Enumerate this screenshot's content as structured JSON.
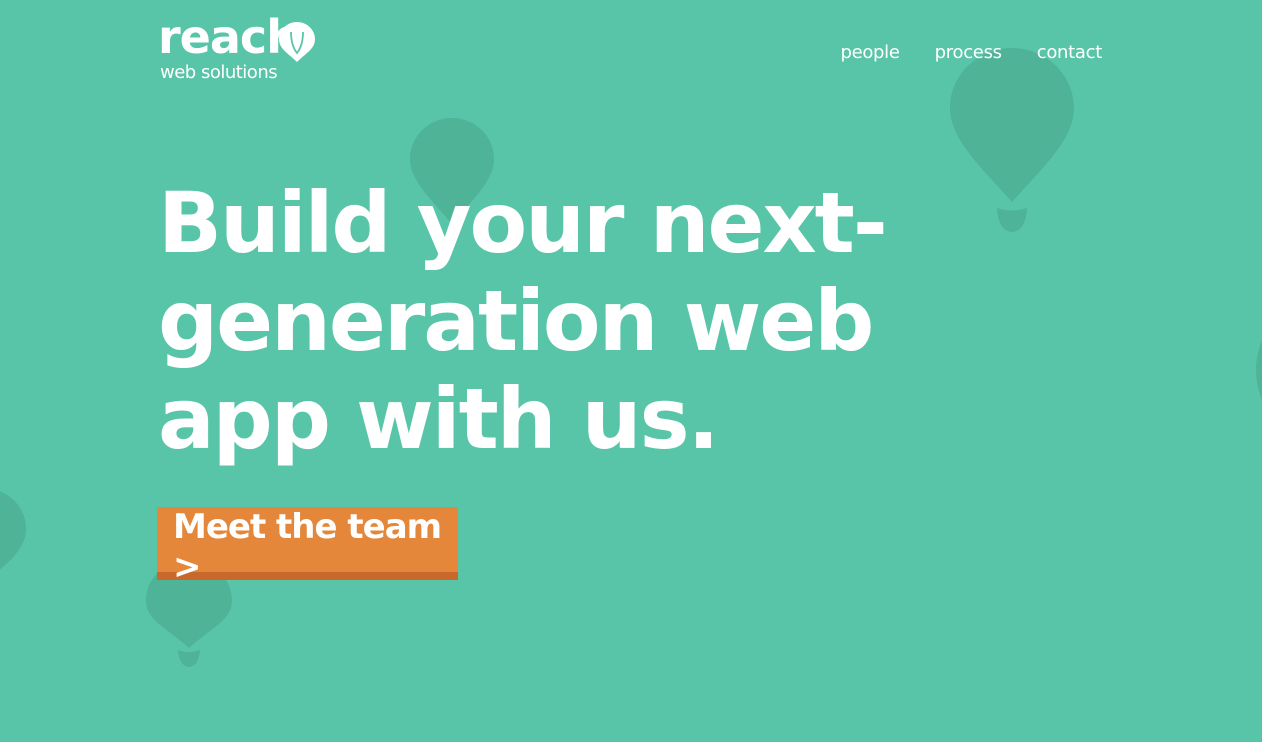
{
  "colors": {
    "background": "#59c5a8",
    "balloon_shade": "#4fb398",
    "cta_fill": "#e5873a",
    "cta_shadow": "#c8682a",
    "text": "#ffffff"
  },
  "header": {
    "logo_word": "reach",
    "logo_tagline": "web solutions",
    "logo_icon": "balloon-icon"
  },
  "nav": {
    "items": [
      {
        "label": "people"
      },
      {
        "label": "process"
      },
      {
        "label": "contact"
      }
    ]
  },
  "hero": {
    "headline": "Build your next-generation web app with us.",
    "cta_label": "Meet the team >"
  },
  "decorations": {
    "icon": "balloon-icon"
  }
}
